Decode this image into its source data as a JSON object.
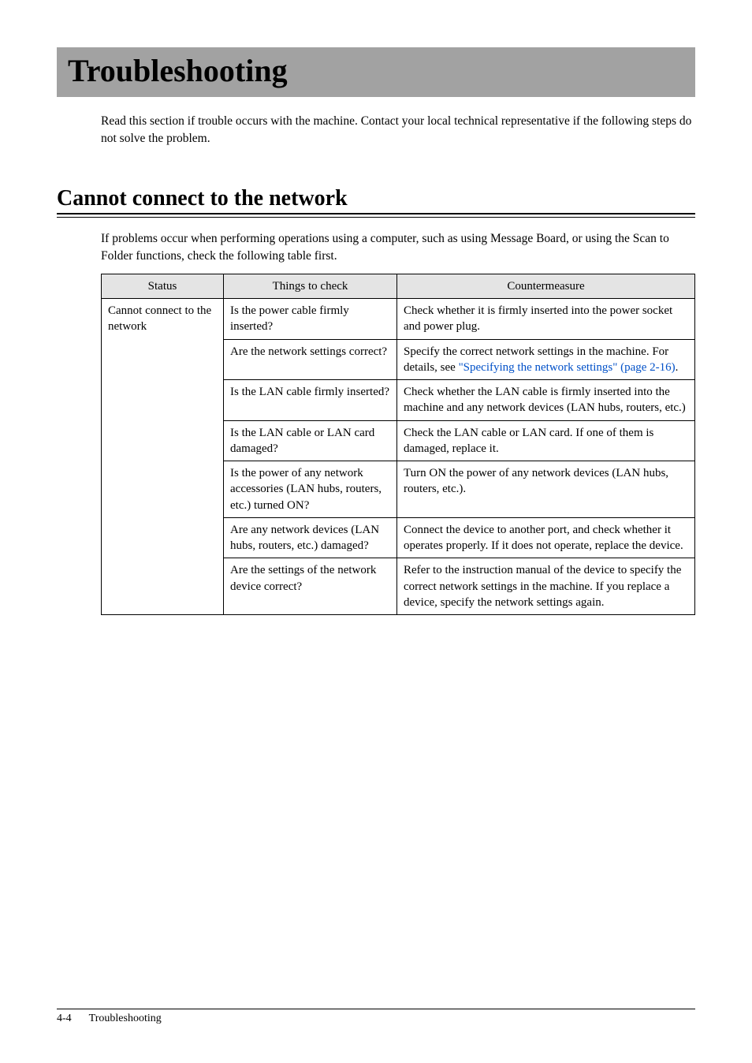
{
  "title": "Troubleshooting",
  "intro": "Read this section if trouble occurs with the machine.  Contact your local technical representative if the following steps do not solve the problem.",
  "section_heading": "Cannot connect to the network",
  "section_intro": "If problems occur when performing operations using a computer, such as using Message Board, or using the Scan to Folder functions, check the following table first.",
  "table": {
    "headers": [
      "Status",
      "Things to check",
      "Countermeasure"
    ],
    "status": "Cannot connect to the network",
    "rows": [
      {
        "check": "Is the power cable firmly inserted?",
        "measure": "Check whether it is firmly inserted into the power socket and power plug."
      },
      {
        "check": "Are the network settings correct?",
        "measure_pre": "Specify the correct network settings in the machine.  For details, see ",
        "measure_link": "\"Specifying the network settings\" (page 2-16)",
        "measure_post": "."
      },
      {
        "check": "Is the LAN cable firmly inserted?",
        "measure": "Check whether the LAN cable is firmly inserted into the machine and any network devices (LAN hubs, routers, etc.)"
      },
      {
        "check": "Is the LAN cable or LAN card damaged?",
        "measure": "Check the LAN cable or LAN card.  If one of them is damaged, replace it."
      },
      {
        "check": "Is the power of any network accessories (LAN hubs, routers, etc.) turned ON?",
        "measure": "Turn ON the power of any network devices (LAN hubs, routers, etc.)."
      },
      {
        "check": "Are any network devices (LAN hubs, routers, etc.) damaged?",
        "measure": "Connect the device to another port, and check whether it operates properly.\nIf it does not operate, replace the device."
      },
      {
        "check": "Are the settings of the network device correct?",
        "measure": "Refer to the instruction manual of the device to specify the correct network settings in the machine.\nIf you replace a device, specify the network settings again."
      }
    ]
  },
  "footer": {
    "page_number": "4-4",
    "section": "Troubleshooting"
  }
}
